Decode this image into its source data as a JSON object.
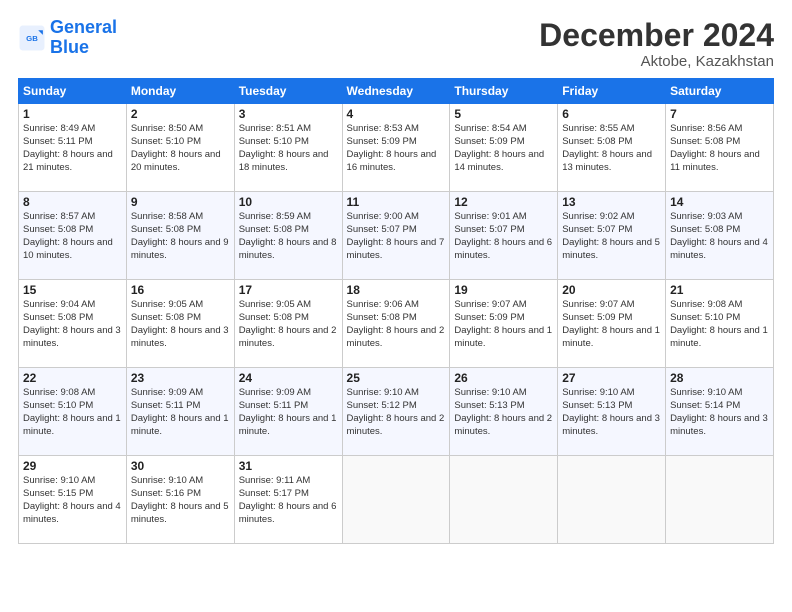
{
  "logo": {
    "line1": "General",
    "line2": "Blue"
  },
  "title": "December 2024",
  "subtitle": "Aktobe, Kazakhstan",
  "days_header": [
    "Sunday",
    "Monday",
    "Tuesday",
    "Wednesday",
    "Thursday",
    "Friday",
    "Saturday"
  ],
  "weeks": [
    [
      {
        "day": "1",
        "sunrise": "8:49 AM",
        "sunset": "5:11 PM",
        "daylight": "8 hours and 21 minutes."
      },
      {
        "day": "2",
        "sunrise": "8:50 AM",
        "sunset": "5:10 PM",
        "daylight": "8 hours and 20 minutes."
      },
      {
        "day": "3",
        "sunrise": "8:51 AM",
        "sunset": "5:10 PM",
        "daylight": "8 hours and 18 minutes."
      },
      {
        "day": "4",
        "sunrise": "8:53 AM",
        "sunset": "5:09 PM",
        "daylight": "8 hours and 16 minutes."
      },
      {
        "day": "5",
        "sunrise": "8:54 AM",
        "sunset": "5:09 PM",
        "daylight": "8 hours and 14 minutes."
      },
      {
        "day": "6",
        "sunrise": "8:55 AM",
        "sunset": "5:08 PM",
        "daylight": "8 hours and 13 minutes."
      },
      {
        "day": "7",
        "sunrise": "8:56 AM",
        "sunset": "5:08 PM",
        "daylight": "8 hours and 11 minutes."
      }
    ],
    [
      {
        "day": "8",
        "sunrise": "8:57 AM",
        "sunset": "5:08 PM",
        "daylight": "8 hours and 10 minutes."
      },
      {
        "day": "9",
        "sunrise": "8:58 AM",
        "sunset": "5:08 PM",
        "daylight": "8 hours and 9 minutes."
      },
      {
        "day": "10",
        "sunrise": "8:59 AM",
        "sunset": "5:08 PM",
        "daylight": "8 hours and 8 minutes."
      },
      {
        "day": "11",
        "sunrise": "9:00 AM",
        "sunset": "5:07 PM",
        "daylight": "8 hours and 7 minutes."
      },
      {
        "day": "12",
        "sunrise": "9:01 AM",
        "sunset": "5:07 PM",
        "daylight": "8 hours and 6 minutes."
      },
      {
        "day": "13",
        "sunrise": "9:02 AM",
        "sunset": "5:07 PM",
        "daylight": "8 hours and 5 minutes."
      },
      {
        "day": "14",
        "sunrise": "9:03 AM",
        "sunset": "5:08 PM",
        "daylight": "8 hours and 4 minutes."
      }
    ],
    [
      {
        "day": "15",
        "sunrise": "9:04 AM",
        "sunset": "5:08 PM",
        "daylight": "8 hours and 3 minutes."
      },
      {
        "day": "16",
        "sunrise": "9:05 AM",
        "sunset": "5:08 PM",
        "daylight": "8 hours and 3 minutes."
      },
      {
        "day": "17",
        "sunrise": "9:05 AM",
        "sunset": "5:08 PM",
        "daylight": "8 hours and 2 minutes."
      },
      {
        "day": "18",
        "sunrise": "9:06 AM",
        "sunset": "5:08 PM",
        "daylight": "8 hours and 2 minutes."
      },
      {
        "day": "19",
        "sunrise": "9:07 AM",
        "sunset": "5:09 PM",
        "daylight": "8 hours and 1 minute."
      },
      {
        "day": "20",
        "sunrise": "9:07 AM",
        "sunset": "5:09 PM",
        "daylight": "8 hours and 1 minute."
      },
      {
        "day": "21",
        "sunrise": "9:08 AM",
        "sunset": "5:10 PM",
        "daylight": "8 hours and 1 minute."
      }
    ],
    [
      {
        "day": "22",
        "sunrise": "9:08 AM",
        "sunset": "5:10 PM",
        "daylight": "8 hours and 1 minute."
      },
      {
        "day": "23",
        "sunrise": "9:09 AM",
        "sunset": "5:11 PM",
        "daylight": "8 hours and 1 minute."
      },
      {
        "day": "24",
        "sunrise": "9:09 AM",
        "sunset": "5:11 PM",
        "daylight": "8 hours and 1 minute."
      },
      {
        "day": "25",
        "sunrise": "9:10 AM",
        "sunset": "5:12 PM",
        "daylight": "8 hours and 2 minutes."
      },
      {
        "day": "26",
        "sunrise": "9:10 AM",
        "sunset": "5:13 PM",
        "daylight": "8 hours and 2 minutes."
      },
      {
        "day": "27",
        "sunrise": "9:10 AM",
        "sunset": "5:13 PM",
        "daylight": "8 hours and 3 minutes."
      },
      {
        "day": "28",
        "sunrise": "9:10 AM",
        "sunset": "5:14 PM",
        "daylight": "8 hours and 3 minutes."
      }
    ],
    [
      {
        "day": "29",
        "sunrise": "9:10 AM",
        "sunset": "5:15 PM",
        "daylight": "8 hours and 4 minutes."
      },
      {
        "day": "30",
        "sunrise": "9:10 AM",
        "sunset": "5:16 PM",
        "daylight": "8 hours and 5 minutes."
      },
      {
        "day": "31",
        "sunrise": "9:11 AM",
        "sunset": "5:17 PM",
        "daylight": "8 hours and 6 minutes."
      },
      null,
      null,
      null,
      null
    ]
  ]
}
